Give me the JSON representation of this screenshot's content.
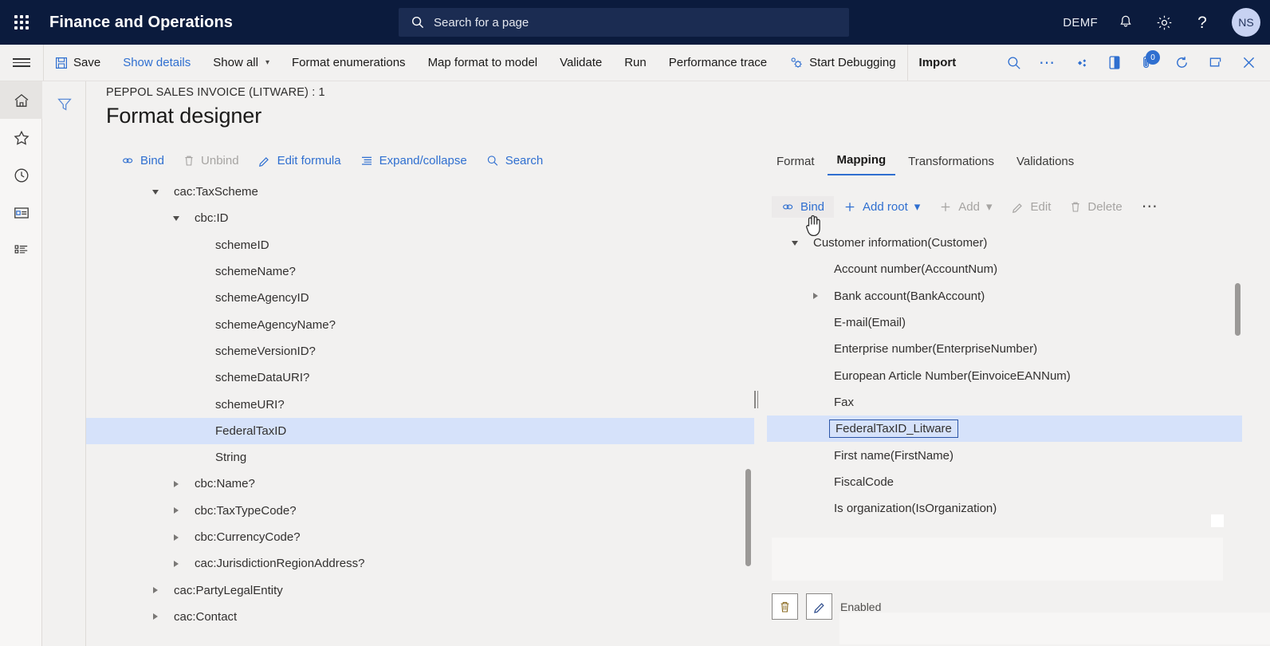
{
  "topnav": {
    "waffle_icon": "app-launcher-icon",
    "app_title": "Finance and Operations",
    "search_placeholder": "Search for a page",
    "search_icon": "search-icon",
    "company": "DEMF",
    "bell_icon": "notifications-icon",
    "gear_icon": "settings-icon",
    "help_icon": "help-icon",
    "avatar_initials": "NS"
  },
  "commandbar": {
    "hamburger_icon": "hamburger-menu-icon",
    "save_label": "Save",
    "save_icon": "save-icon",
    "show_details_label": "Show details",
    "show_all_label": "Show all",
    "show_all_chevron": "chevron-down-icon",
    "format_enumerations_label": "Format enumerations",
    "map_format_to_model_label": "Map format to model",
    "validate_label": "Validate",
    "run_label": "Run",
    "performance_trace_label": "Performance trace",
    "start_debugging_label": "Start Debugging",
    "start_debugging_icon": "debug-gear-icon",
    "import_label": "Import",
    "search_icon": "search-icon",
    "overflow_icon": "ellipsis-icon",
    "share_icon": "share-icon",
    "office_icon": "office-app-icon",
    "attachment_icon": "attachment-icon",
    "attachment_badge": "0",
    "refresh_icon": "refresh-icon",
    "popout_icon": "open-in-new-window-icon",
    "close_icon": "close-icon"
  },
  "rail": {
    "items": [
      {
        "name": "home",
        "icon": "home-icon",
        "active": true
      },
      {
        "name": "favorites",
        "icon": "star-icon",
        "active": false
      },
      {
        "name": "recent",
        "icon": "clock-icon",
        "active": false
      },
      {
        "name": "workspaces",
        "icon": "workspace-icon",
        "active": false
      },
      {
        "name": "modules",
        "icon": "list-icon",
        "active": false
      }
    ]
  },
  "filter_icon": "filter-funnel-icon",
  "page": {
    "breadcrumb": "PEPPOL SALES INVOICE (LITWARE) : 1",
    "title": "Format designer"
  },
  "left_toolbar": {
    "buttons": [
      {
        "label": "Bind",
        "icon": "link-bind-icon",
        "state": "enabled"
      },
      {
        "label": "Unbind",
        "icon": "trash-icon",
        "state": "disabled"
      },
      {
        "label": "Edit formula",
        "icon": "pencil-icon",
        "state": "enabled"
      },
      {
        "label": "Expand/collapse",
        "icon": "expand-collapse-icon",
        "state": "enabled"
      },
      {
        "label": "Search",
        "icon": "search-icon",
        "state": "enabled"
      }
    ]
  },
  "left_tree": {
    "rows": [
      {
        "label": "cac:TaxScheme",
        "indent": 1,
        "toggle": "down",
        "selected": false
      },
      {
        "label": "cbc:ID",
        "indent": 2,
        "toggle": "down",
        "selected": false
      },
      {
        "label": "schemeID",
        "indent": 3,
        "toggle": "none",
        "selected": false
      },
      {
        "label": "schemeName?",
        "indent": 3,
        "toggle": "none",
        "selected": false
      },
      {
        "label": "schemeAgencyID",
        "indent": 3,
        "toggle": "none",
        "selected": false
      },
      {
        "label": "schemeAgencyName?",
        "indent": 3,
        "toggle": "none",
        "selected": false
      },
      {
        "label": "schemeVersionID?",
        "indent": 3,
        "toggle": "none",
        "selected": false
      },
      {
        "label": "schemeDataURI?",
        "indent": 3,
        "toggle": "none",
        "selected": false
      },
      {
        "label": "schemeURI?",
        "indent": 3,
        "toggle": "none",
        "selected": false
      },
      {
        "label": "FederalTaxID",
        "indent": 3,
        "toggle": "none",
        "selected": true
      },
      {
        "label": "String",
        "indent": 3,
        "toggle": "none",
        "selected": false
      },
      {
        "label": "cbc:Name?",
        "indent": 2,
        "toggle": "right",
        "selected": false
      },
      {
        "label": "cbc:TaxTypeCode?",
        "indent": 2,
        "toggle": "right",
        "selected": false
      },
      {
        "label": "cbc:CurrencyCode?",
        "indent": 2,
        "toggle": "right",
        "selected": false
      },
      {
        "label": "cac:JurisdictionRegionAddress?",
        "indent": 2,
        "toggle": "right",
        "selected": false
      },
      {
        "label": "cac:PartyLegalEntity",
        "indent": 1,
        "toggle": "right",
        "selected": false
      },
      {
        "label": "cac:Contact",
        "indent": 1,
        "toggle": "right",
        "selected": false
      }
    ]
  },
  "right_tabs": [
    {
      "label": "Format",
      "active": false
    },
    {
      "label": "Mapping",
      "active": true
    },
    {
      "label": "Transformations",
      "active": false
    },
    {
      "label": "Validations",
      "active": false
    }
  ],
  "right_toolbar": {
    "buttons": [
      {
        "label": "Bind",
        "icon": "link-bind-icon",
        "state": "hover"
      },
      {
        "label": "Add root",
        "icon": "plus-icon",
        "state": "enabled",
        "chevron": "chevron-down-icon"
      },
      {
        "label": "Add",
        "icon": "plus-icon",
        "state": "disabled",
        "chevron": "chevron-down-icon"
      },
      {
        "label": "Edit",
        "icon": "pencil-icon",
        "state": "disabled"
      },
      {
        "label": "Delete",
        "icon": "trash-icon",
        "state": "disabled"
      },
      {
        "label": "",
        "icon": "ellipsis-icon",
        "state": "enabled"
      }
    ]
  },
  "right_tree": {
    "rows": [
      {
        "label": "Customer information(Customer)",
        "indent": 1,
        "toggle": "down",
        "selected": false
      },
      {
        "label": "Account number(AccountNum)",
        "indent": 2,
        "toggle": "none",
        "selected": false
      },
      {
        "label": "Bank account(BankAccount)",
        "indent": 2,
        "toggle": "right",
        "selected": false
      },
      {
        "label": "E-mail(Email)",
        "indent": 2,
        "toggle": "none",
        "selected": false
      },
      {
        "label": "Enterprise number(EnterpriseNumber)",
        "indent": 2,
        "toggle": "none",
        "selected": false
      },
      {
        "label": "European Article Number(EinvoiceEANNum)",
        "indent": 2,
        "toggle": "none",
        "selected": false
      },
      {
        "label": "Fax",
        "indent": 2,
        "toggle": "none",
        "selected": false
      },
      {
        "label": "FederalTaxID_Litware",
        "indent": 2,
        "toggle": "none",
        "selected": true,
        "focused": true
      },
      {
        "label": "First name(FirstName)",
        "indent": 2,
        "toggle": "none",
        "selected": false
      },
      {
        "label": "FiscalCode",
        "indent": 2,
        "toggle": "none",
        "selected": false
      },
      {
        "label": "Is organization(IsOrganization)",
        "indent": 2,
        "toggle": "none",
        "selected": false
      }
    ]
  },
  "bottom": {
    "delete_icon": "trash-icon",
    "edit_icon": "pencil-icon",
    "enabled_label": "Enabled"
  },
  "colors": {
    "nav_background": "#0b1b3d",
    "accent_blue": "#2f6fd0",
    "selection_blue": "#d6e2fa",
    "page_background": "#f2f1f0",
    "avatar_background": "#c7d2f2"
  }
}
